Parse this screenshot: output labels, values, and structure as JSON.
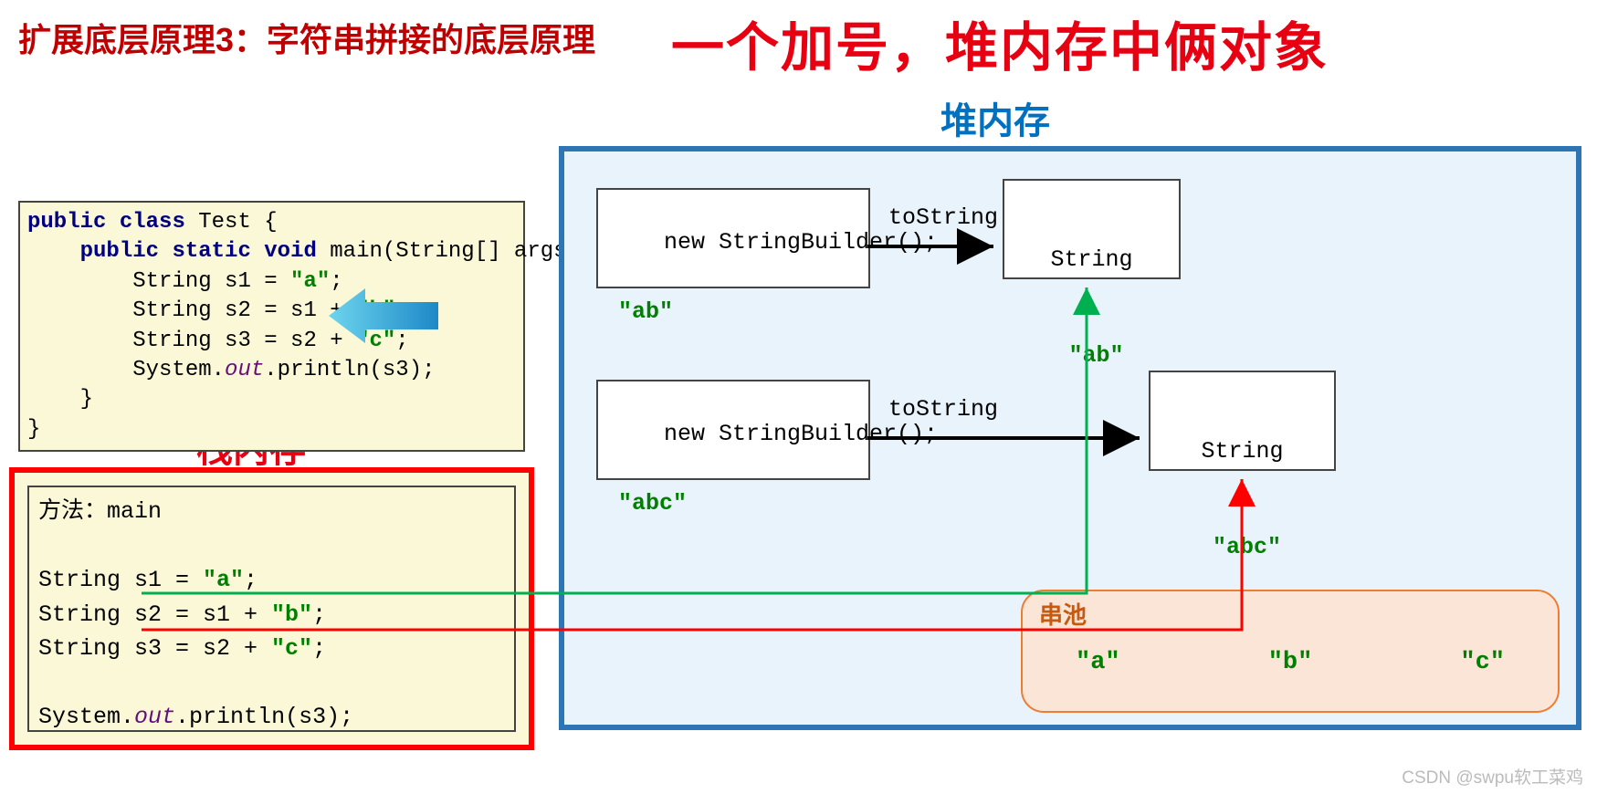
{
  "titles": {
    "subtitle": "扩展底层原理3：字符串拼接的底层原理",
    "headline": "一个加号，堆内存中俩对象",
    "heap": "堆内存",
    "stack": "栈内存"
  },
  "code": {
    "l1a": "public",
    "l1b": "class",
    "l1c": " Test {",
    "l2a": "    public",
    "l2b": "static",
    "l2c": "void",
    "l2d": " main(String[] args) {",
    "l3a": "        String s1 = ",
    "l3s": "\"a\"",
    "l3b": ";",
    "l4a": "        String s2 = s1 + ",
    "l4s": "\"b\"",
    "l4b": ";",
    "l5a": "        String s3 = s2 + ",
    "l5s": "\"c\"",
    "l5b": ";",
    "l6a": "        System.",
    "l6out": "out",
    "l6b": ".println(s3);",
    "l7": "    }",
    "l8": "}"
  },
  "stack": {
    "l1": "方法：main",
    "l2": "",
    "l3a": "String s1 = ",
    "l3s": "\"a\"",
    "l3b": ";",
    "l4a": "String s2 = s1 + ",
    "l4s": "\"b\"",
    "l4b": ";",
    "l5a": "String s3 = s2 + ",
    "l5s": "\"c\"",
    "l5b": ";",
    "l6": "",
    "l7a": "System.",
    "l7out": "out",
    "l7b": ".println(s3);"
  },
  "heap": {
    "sb1": {
      "text": "new StringBuilder();",
      "value": "\"ab\""
    },
    "sb2": {
      "text": "new StringBuilder();",
      "value": "\"abc\""
    },
    "tostring": "toString",
    "str1": {
      "title": "String",
      "value": "\"ab\""
    },
    "str2": {
      "title": "String",
      "value": "\"abc\""
    },
    "pool": {
      "label": "串池",
      "a": "\"a\"",
      "b": "\"b\"",
      "c": "\"c\""
    }
  },
  "watermark": "CSDN @swpu软工菜鸡"
}
